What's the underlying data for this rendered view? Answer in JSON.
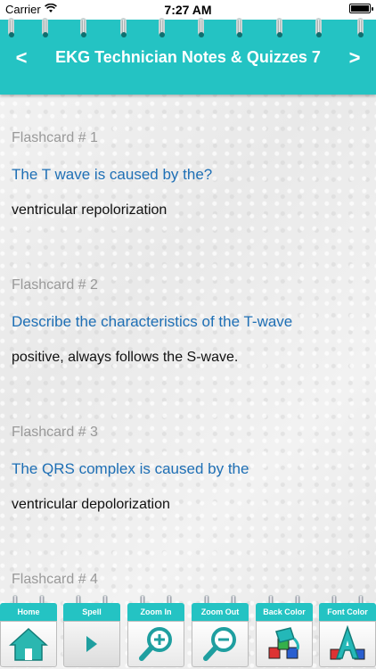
{
  "status_bar": {
    "carrier": "Carrier",
    "time": "7:27 AM"
  },
  "header": {
    "title": "EKG Technician Notes & Quizzes 7",
    "prev": "<",
    "next": ">"
  },
  "cards": [
    {
      "label": "Flashcard # 1",
      "question": "The T wave is caused by the?",
      "answer": "ventricular repolorization"
    },
    {
      "label": "Flashcard # 2",
      "question": "Describe the characteristics of the T-wave",
      "answer": "positive, always follows the S-wave."
    },
    {
      "label": "Flashcard # 3",
      "question": "The QRS complex is caused by the",
      "answer": "ventricular depolorization"
    },
    {
      "label": "Flashcard # 4"
    }
  ],
  "toolbar": {
    "items": [
      {
        "label": "Home",
        "icon": "home-icon"
      },
      {
        "label": "Spell",
        "icon": "play-icon"
      },
      {
        "label": "Zoom In",
        "icon": "zoom-in-icon"
      },
      {
        "label": "Zoom Out",
        "icon": "zoom-out-icon"
      },
      {
        "label": "Back Color",
        "icon": "paint-bucket-icon"
      },
      {
        "label": "Font Color",
        "icon": "font-color-icon"
      }
    ]
  },
  "colors": {
    "accent": "#24c3c3",
    "question": "#1e6fb5",
    "label": "#999999",
    "answer": "#111111"
  }
}
